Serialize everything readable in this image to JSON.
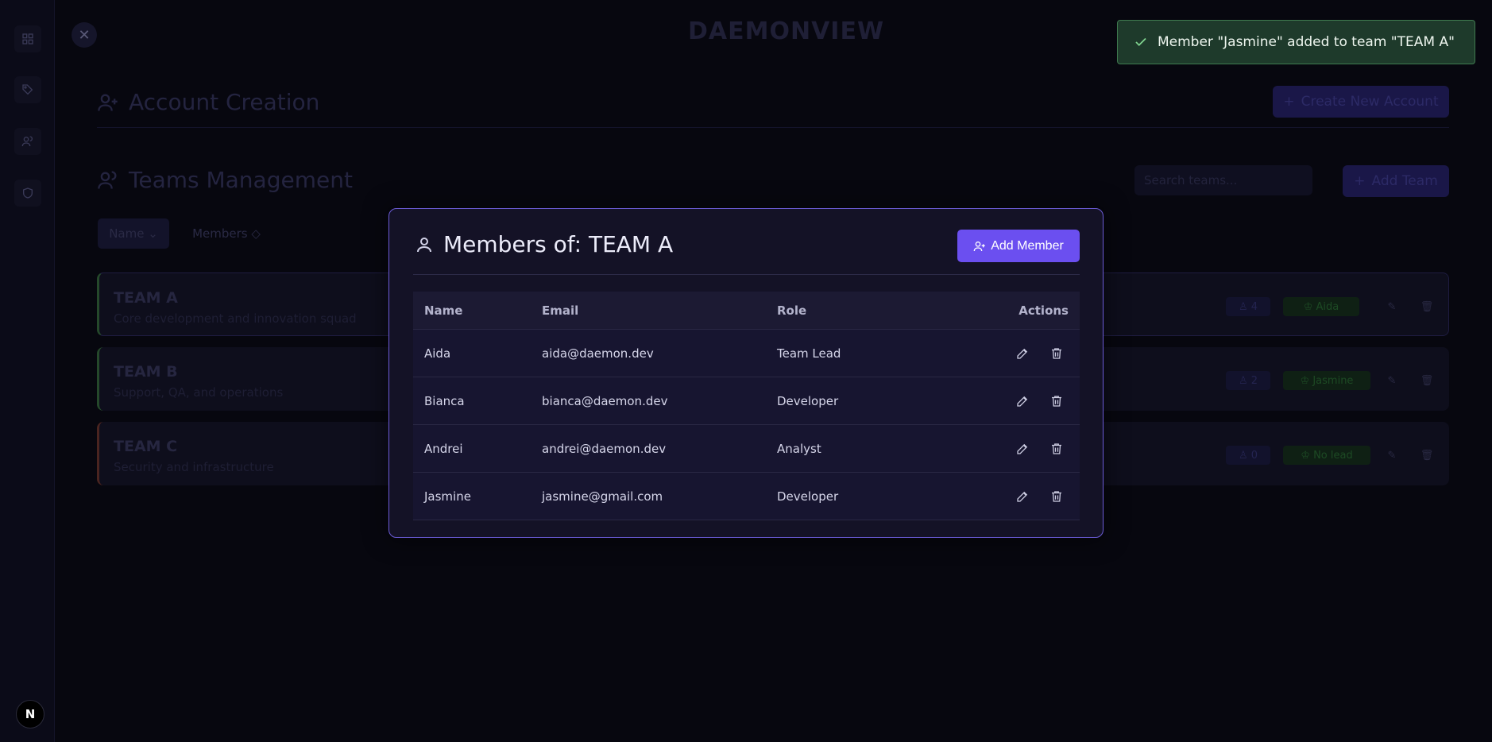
{
  "app": {
    "brand": "DAEMONVIEW"
  },
  "background": {
    "account_title": "Account Creation",
    "create_account_label": "Create New Account",
    "teams_title": "Teams Management",
    "search_placeholder": "Search teams...",
    "add_team_label": "Add Team",
    "sort_name_label": "Name",
    "sort_members_label": "Members",
    "teams": [
      {
        "name": "TEAM A",
        "description": "Core development and innovation squad",
        "count": "4",
        "lead": "Aida",
        "accent": "#3a6e3f"
      },
      {
        "name": "TEAM B",
        "description": "Support, QA, and operations",
        "count": "2",
        "lead": "Jasmine",
        "accent": "#3a6e3f"
      },
      {
        "name": "TEAM C",
        "description": "Security and infrastructure",
        "count": "0",
        "lead": "No lead",
        "accent": "#6e2f2a"
      }
    ]
  },
  "modal": {
    "title": "Members of: TEAM A",
    "add_member_label": "Add Member",
    "columns": {
      "name": "Name",
      "email": "Email",
      "role": "Role",
      "actions": "Actions"
    },
    "members": [
      {
        "name": "Aida",
        "email": "aida@daemon.dev",
        "role": "Team Lead"
      },
      {
        "name": "Bianca",
        "email": "bianca@daemon.dev",
        "role": "Developer"
      },
      {
        "name": "Andrei",
        "email": "andrei@daemon.dev",
        "role": "Analyst"
      },
      {
        "name": "Jasmine",
        "email": "jasmine@gmail.com",
        "role": "Developer"
      }
    ]
  },
  "toast": {
    "message": "Member \"Jasmine\" added to team \"TEAM A\""
  },
  "colors": {
    "accent": "#6b4ff0",
    "toast_bg": "#1e3a2b",
    "modal_border": "#6b5bd6"
  }
}
